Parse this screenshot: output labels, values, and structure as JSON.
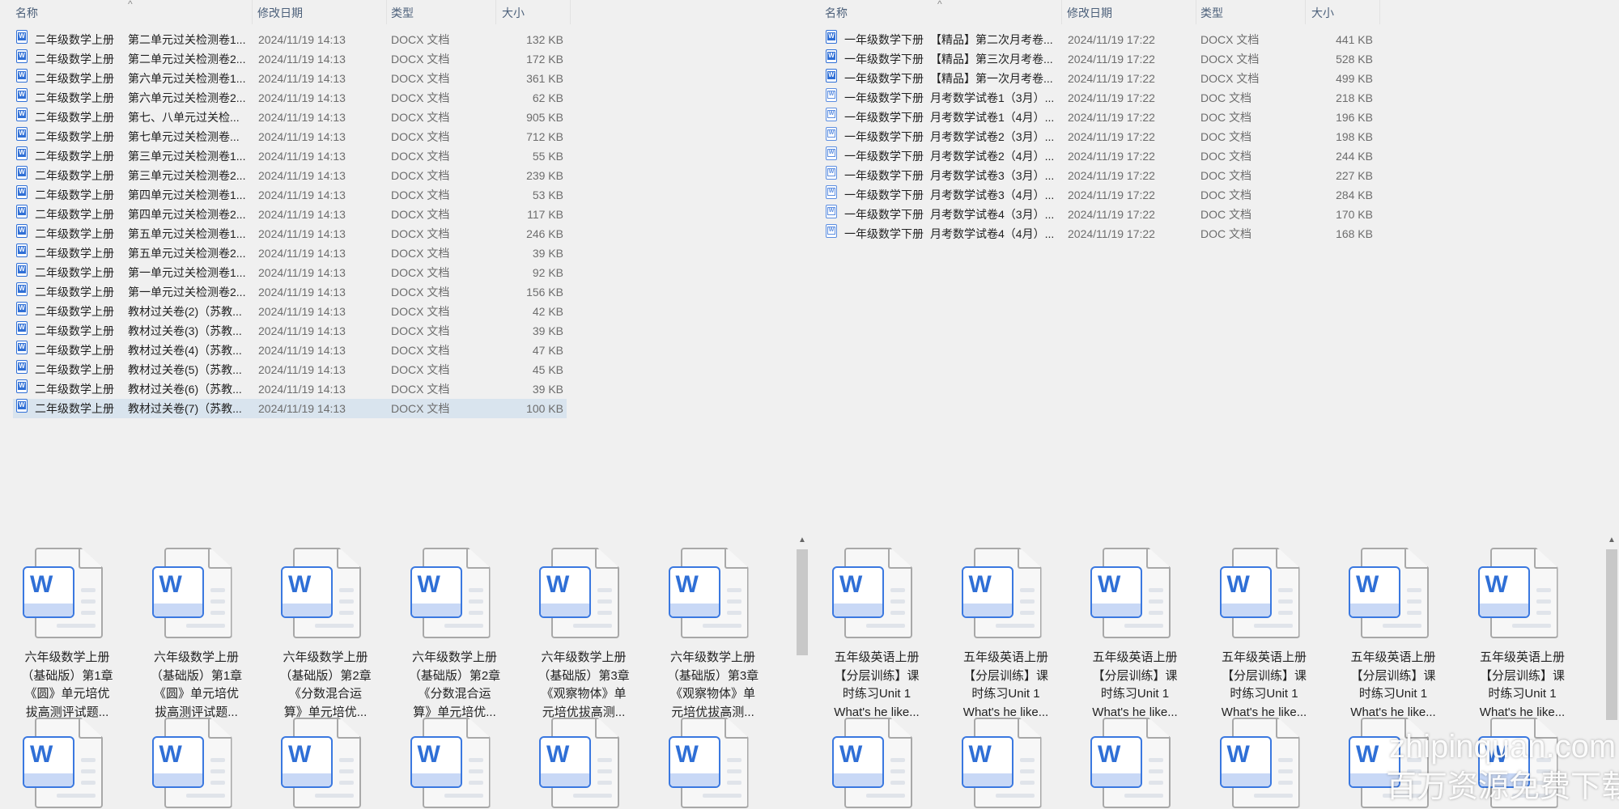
{
  "top_left": {
    "headers": {
      "name": "名称",
      "date": "修改日期",
      "type": "类型",
      "size": "大小"
    },
    "rows": [
      {
        "prefix": "二年级数学上册",
        "title": "第二单元过关检测卷1...",
        "date": "2024/11/19 14:13",
        "type": "DOCX 文档",
        "size": "132 KB",
        "icon": "docx"
      },
      {
        "prefix": "二年级数学上册",
        "title": "第二单元过关检测卷2...",
        "date": "2024/11/19 14:13",
        "type": "DOCX 文档",
        "size": "172 KB",
        "icon": "docx"
      },
      {
        "prefix": "二年级数学上册",
        "title": "第六单元过关检测卷1...",
        "date": "2024/11/19 14:13",
        "type": "DOCX 文档",
        "size": "361 KB",
        "icon": "docx"
      },
      {
        "prefix": "二年级数学上册",
        "title": "第六单元过关检测卷2...",
        "date": "2024/11/19 14:13",
        "type": "DOCX 文档",
        "size": "62 KB",
        "icon": "docx"
      },
      {
        "prefix": "二年级数学上册",
        "title": "第七、八单元过关检...",
        "date": "2024/11/19 14:13",
        "type": "DOCX 文档",
        "size": "905 KB",
        "icon": "docx"
      },
      {
        "prefix": "二年级数学上册",
        "title": "第七单元过关检测卷...",
        "date": "2024/11/19 14:13",
        "type": "DOCX 文档",
        "size": "712 KB",
        "icon": "docx"
      },
      {
        "prefix": "二年级数学上册",
        "title": "第三单元过关检测卷1...",
        "date": "2024/11/19 14:13",
        "type": "DOCX 文档",
        "size": "55 KB",
        "icon": "docx"
      },
      {
        "prefix": "二年级数学上册",
        "title": "第三单元过关检测卷2...",
        "date": "2024/11/19 14:13",
        "type": "DOCX 文档",
        "size": "239 KB",
        "icon": "docx"
      },
      {
        "prefix": "二年级数学上册",
        "title": "第四单元过关检测卷1...",
        "date": "2024/11/19 14:13",
        "type": "DOCX 文档",
        "size": "53 KB",
        "icon": "docx"
      },
      {
        "prefix": "二年级数学上册",
        "title": "第四单元过关检测卷2...",
        "date": "2024/11/19 14:13",
        "type": "DOCX 文档",
        "size": "117 KB",
        "icon": "docx"
      },
      {
        "prefix": "二年级数学上册",
        "title": "第五单元过关检测卷1...",
        "date": "2024/11/19 14:13",
        "type": "DOCX 文档",
        "size": "246 KB",
        "icon": "docx"
      },
      {
        "prefix": "二年级数学上册",
        "title": "第五单元过关检测卷2...",
        "date": "2024/11/19 14:13",
        "type": "DOCX 文档",
        "size": "39 KB",
        "icon": "docx"
      },
      {
        "prefix": "二年级数学上册",
        "title": "第一单元过关检测卷1...",
        "date": "2024/11/19 14:13",
        "type": "DOCX 文档",
        "size": "92 KB",
        "icon": "docx"
      },
      {
        "prefix": "二年级数学上册",
        "title": "第一单元过关检测卷2...",
        "date": "2024/11/19 14:13",
        "type": "DOCX 文档",
        "size": "156 KB",
        "icon": "docx"
      },
      {
        "prefix": "二年级数学上册",
        "title": "教材过关卷(2)（苏教...",
        "date": "2024/11/19 14:13",
        "type": "DOCX 文档",
        "size": "42 KB",
        "icon": "docx"
      },
      {
        "prefix": "二年级数学上册",
        "title": "教材过关卷(3)（苏教...",
        "date": "2024/11/19 14:13",
        "type": "DOCX 文档",
        "size": "39 KB",
        "icon": "docx"
      },
      {
        "prefix": "二年级数学上册",
        "title": "教材过关卷(4)（苏教...",
        "date": "2024/11/19 14:13",
        "type": "DOCX 文档",
        "size": "47 KB",
        "icon": "docx"
      },
      {
        "prefix": "二年级数学上册",
        "title": "教材过关卷(5)（苏教...",
        "date": "2024/11/19 14:13",
        "type": "DOCX 文档",
        "size": "45 KB",
        "icon": "docx"
      },
      {
        "prefix": "二年级数学上册",
        "title": "教材过关卷(6)（苏教...",
        "date": "2024/11/19 14:13",
        "type": "DOCX 文档",
        "size": "39 KB",
        "icon": "docx"
      },
      {
        "prefix": "二年级数学上册",
        "title": "教材过关卷(7)（苏教...",
        "date": "2024/11/19 14:13",
        "type": "DOCX 文档",
        "size": "100 KB",
        "icon": "docx",
        "selected": true
      }
    ]
  },
  "top_right": {
    "headers": {
      "name": "名称",
      "date": "修改日期",
      "type": "类型",
      "size": "大小"
    },
    "rows": [
      {
        "prefix": "一年级数学下册",
        "title": "【精品】第二次月考卷...",
        "date": "2024/11/19 17:22",
        "type": "DOCX 文档",
        "size": "441 KB",
        "icon": "docx"
      },
      {
        "prefix": "一年级数学下册",
        "title": "【精品】第三次月考卷...",
        "date": "2024/11/19 17:22",
        "type": "DOCX 文档",
        "size": "528 KB",
        "icon": "docx"
      },
      {
        "prefix": "一年级数学下册",
        "title": "【精品】第一次月考卷...",
        "date": "2024/11/19 17:22",
        "type": "DOCX 文档",
        "size": "499 KB",
        "icon": "docx"
      },
      {
        "prefix": "一年级数学下册",
        "title": "月考数学试卷1（3月）...",
        "date": "2024/11/19 17:22",
        "type": "DOC 文档",
        "size": "218 KB",
        "icon": "doc"
      },
      {
        "prefix": "一年级数学下册",
        "title": "月考数学试卷1（4月）...",
        "date": "2024/11/19 17:22",
        "type": "DOC 文档",
        "size": "196 KB",
        "icon": "doc"
      },
      {
        "prefix": "一年级数学下册",
        "title": "月考数学试卷2（3月）...",
        "date": "2024/11/19 17:22",
        "type": "DOC 文档",
        "size": "198 KB",
        "icon": "doc"
      },
      {
        "prefix": "一年级数学下册",
        "title": "月考数学试卷2（4月）...",
        "date": "2024/11/19 17:22",
        "type": "DOC 文档",
        "size": "244 KB",
        "icon": "doc"
      },
      {
        "prefix": "一年级数学下册",
        "title": "月考数学试卷3（3月）...",
        "date": "2024/11/19 17:22",
        "type": "DOC 文档",
        "size": "227 KB",
        "icon": "doc"
      },
      {
        "prefix": "一年级数学下册",
        "title": "月考数学试卷3（4月）...",
        "date": "2024/11/19 17:22",
        "type": "DOC 文档",
        "size": "284 KB",
        "icon": "doc"
      },
      {
        "prefix": "一年级数学下册",
        "title": "月考数学试卷4（3月）...",
        "date": "2024/11/19 17:22",
        "type": "DOC 文档",
        "size": "170 KB",
        "icon": "doc"
      },
      {
        "prefix": "一年级数学下册",
        "title": "月考数学试卷4（4月）...",
        "date": "2024/11/19 17:22",
        "type": "DOC 文档",
        "size": "168 KB",
        "icon": "doc"
      }
    ]
  },
  "bottom_left": {
    "tiles": [
      {
        "lines": [
          "六年级数学上册",
          "（基础版）第1章",
          "《圆》单元培优",
          "拔高测评试题..."
        ]
      },
      {
        "lines": [
          "六年级数学上册",
          "（基础版）第1章",
          "《圆》单元培优",
          "拔高测评试题..."
        ]
      },
      {
        "lines": [
          "六年级数学上册",
          "（基础版）第2章",
          "《分数混合运",
          "算》单元培优..."
        ]
      },
      {
        "lines": [
          "六年级数学上册",
          "（基础版）第2章",
          "《分数混合运",
          "算》单元培优..."
        ]
      },
      {
        "lines": [
          "六年级数学上册",
          "（基础版）第3章",
          "《观察物体》单",
          "元培优拔高测..."
        ]
      },
      {
        "lines": [
          "六年级数学上册",
          "（基础版）第3章",
          "《观察物体》单",
          "元培优拔高测..."
        ]
      },
      {
        "lines": []
      },
      {
        "lines": []
      },
      {
        "lines": []
      },
      {
        "lines": []
      },
      {
        "lines": []
      },
      {
        "lines": []
      }
    ],
    "scroll_fraction": 0.3
  },
  "bottom_right": {
    "tiles": [
      {
        "lines": [
          "五年级英语上册",
          "【分层训练】课",
          "时练习Unit 1",
          "What's he like..."
        ]
      },
      {
        "lines": [
          "五年级英语上册",
          "【分层训练】课",
          "时练习Unit 1",
          "What's he like..."
        ]
      },
      {
        "lines": [
          "五年级英语上册",
          "【分层训练】课",
          "时练习Unit 1",
          "What's he like..."
        ]
      },
      {
        "lines": [
          "五年级英语上册",
          "【分层训练】课",
          "时练习Unit 1",
          "What's he like..."
        ]
      },
      {
        "lines": [
          "五年级英语上册",
          "【分层训练】课",
          "时练习Unit 1",
          "What's he like..."
        ]
      },
      {
        "lines": [
          "五年级英语上册",
          "【分层训练】课",
          "时练习Unit 1",
          "What's he like..."
        ]
      },
      {
        "lines": []
      },
      {
        "lines": []
      },
      {
        "lines": []
      },
      {
        "lines": []
      },
      {
        "lines": []
      },
      {
        "lines": []
      }
    ],
    "scroll_fraction": 0.55
  },
  "watermark": {
    "line1": "zhipinquan.com",
    "line2": "百万资源免费下载"
  },
  "colors": {
    "accent": "#2f6fd6",
    "selected_row": "#d9e4ee",
    "background": "#f0f0f0"
  }
}
